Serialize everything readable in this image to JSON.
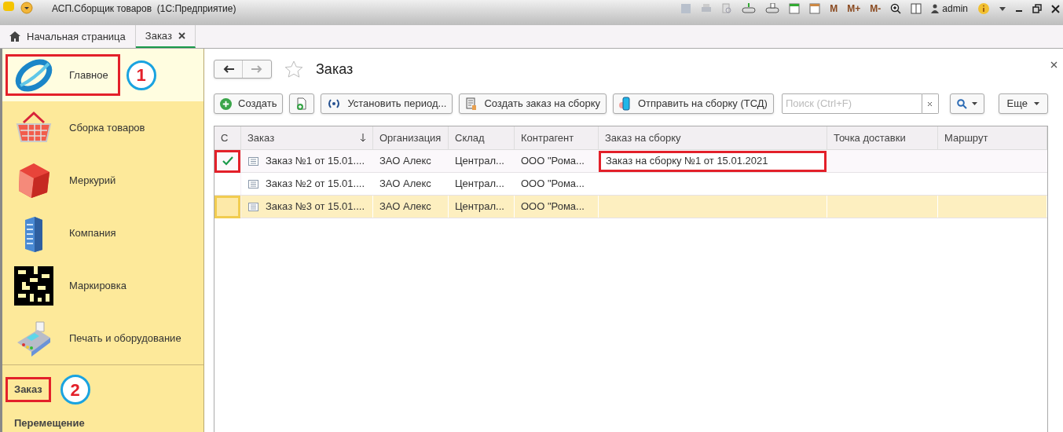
{
  "window": {
    "title": "АСП.Сборщик товаров  (1С:Предприятие)",
    "memory_buttons": [
      "M",
      "M+",
      "M-"
    ],
    "user": "admin"
  },
  "tabs": [
    {
      "label": "Начальная страница",
      "selected": false,
      "kind": "home"
    },
    {
      "label": "Заказ",
      "selected": true,
      "kind": "closable"
    }
  ],
  "sidebar": {
    "sections": [
      {
        "label": "Главное",
        "kind": "main",
        "selected": true,
        "annotated": true,
        "marker": "1"
      },
      {
        "label": "Сборка товаров",
        "kind": "basket",
        "selected": false,
        "annotated": false
      },
      {
        "label": "Меркурий",
        "kind": "cube",
        "selected": false,
        "annotated": false
      },
      {
        "label": "Компания",
        "kind": "building",
        "selected": false,
        "annotated": false
      },
      {
        "label": "Маркировка",
        "kind": "code",
        "selected": false,
        "annotated": false
      },
      {
        "label": "Печать и оборудование",
        "kind": "terminal",
        "selected": false,
        "annotated": false
      }
    ],
    "commands": [
      {
        "label": "Заказ",
        "annotated": true,
        "marker": "2"
      },
      {
        "label": "Перемещение",
        "annotated": false
      }
    ]
  },
  "form": {
    "title": "Заказ",
    "buttons": [
      {
        "label": "Создать",
        "kind": "create"
      },
      {
        "kind": "copy"
      },
      {
        "label": "Установить период...",
        "kind": "period"
      },
      {
        "label": "Создать заказ на сборку",
        "kind": "doc"
      },
      {
        "label": "Отправить на сборку (ТСД)",
        "kind": "phone"
      }
    ],
    "search": {
      "placeholder": "Поиск (Ctrl+F)"
    },
    "more": "Еще"
  },
  "table": {
    "check_column": "С",
    "columns": [
      {
        "label": "Заказ",
        "sorted": true
      },
      {
        "label": "Организация"
      },
      {
        "label": "Склад"
      },
      {
        "label": "Контрагент"
      },
      {
        "label": "Заказ на сборку"
      },
      {
        "label": "Точка доставки"
      },
      {
        "label": "Маршрут"
      }
    ],
    "rows": [
      {
        "checked": true,
        "selected": false,
        "annotated": true,
        "cells": [
          "Заказ №1 от 15.01....",
          "ЗАО Алекс",
          "Централ...",
          "ООО \"Рома...",
          "Заказ на сборку №1 от 15.01.2021",
          "",
          ""
        ]
      },
      {
        "checked": false,
        "selected": false,
        "annotated": false,
        "cells": [
          "Заказ №2 от 15.01....",
          "ЗАО Алекс",
          "Централ...",
          "ООО \"Рома...",
          "",
          "",
          ""
        ]
      },
      {
        "checked": false,
        "selected": true,
        "annotated": false,
        "cells": [
          "Заказ №3 от 15.01....",
          "ЗАО Алекс",
          "Централ...",
          "ООО \"Рома...",
          "",
          "",
          ""
        ]
      }
    ]
  }
}
